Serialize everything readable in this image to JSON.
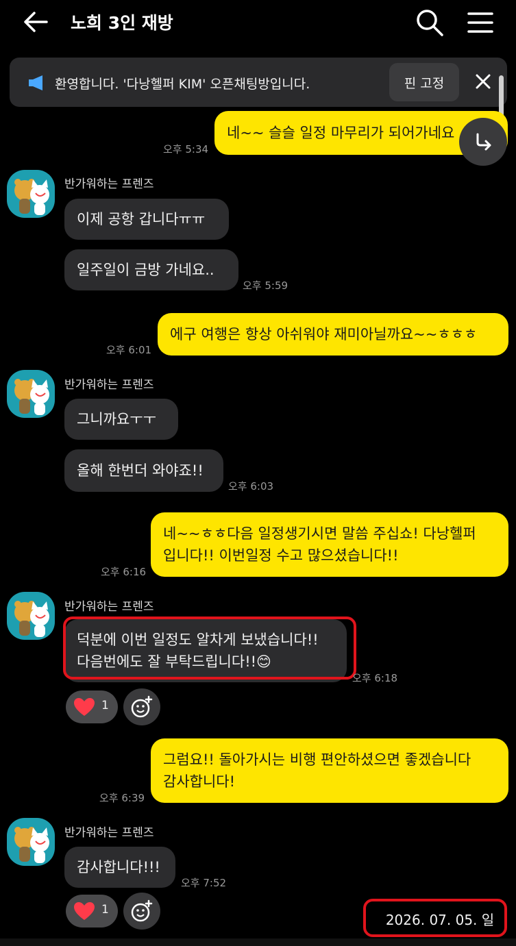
{
  "header": {
    "title": "노희 3인 재방",
    "icons": [
      "back-arrow-icon",
      "search-icon",
      "menu-icon"
    ]
  },
  "notice": {
    "text": "환영합니다. '다낭헬퍼 KIM' 오픈채팅방입니다.",
    "pin_label": "핀 고정",
    "icon": "megaphone-icon"
  },
  "colors": {
    "my_bubble": "#fee500",
    "their_bubble": "#2c2c2e",
    "background": "#000000",
    "highlight": "#e0141c"
  },
  "messages": [
    {
      "from": "me",
      "text": "네~~ 슬슬 일정 마무리가 되어가네요",
      "time": "오후 5:34"
    },
    {
      "from": "them",
      "sender": "반가워하는 프렌즈",
      "text": "이제 공항 갑니다ㅠㅠ"
    },
    {
      "from": "them",
      "text": "일주일이 금방 가네요..",
      "time": "오후 5:59"
    },
    {
      "from": "me",
      "text": "에구 여행은 항상 아쉬워야 재미아닐까요~~ㅎㅎㅎ",
      "time": "오후 6:01"
    },
    {
      "from": "them",
      "sender": "반가워하는 프렌즈",
      "text": "그니까요ㅜㅜ"
    },
    {
      "from": "them",
      "text": "올해 한번더 와야죠!!",
      "time": "오후 6:03"
    },
    {
      "from": "me",
      "lines": [
        "네~~ㅎㅎ다음 일정생기시면 말씀 주십쇼! 다낭헬퍼",
        "입니다!! 이번일정 수고 많으셨습니다!!"
      ],
      "time": "오후 6:16"
    },
    {
      "from": "them",
      "sender": "반가워하는 프렌즈",
      "lines": [
        "덕분에 이번 일정도 알차게 보냈습니다!!",
        "다음번에도 잘 부탁드립니다!!😊"
      ],
      "time": "오후 6:18",
      "reaction_count": "1"
    },
    {
      "from": "me",
      "lines": [
        "그럼요!! 돌아가시는 비행 편안하셨으면 좋겠습니다",
        "감사합니다!"
      ],
      "time": "오후 6:39"
    },
    {
      "from": "them",
      "sender": "반가워하는 프렌즈",
      "text": "감사합니다!!!",
      "time": "오후 7:52",
      "reaction_count": "1"
    }
  ],
  "date_chip": "2026. 07. 05. 일"
}
